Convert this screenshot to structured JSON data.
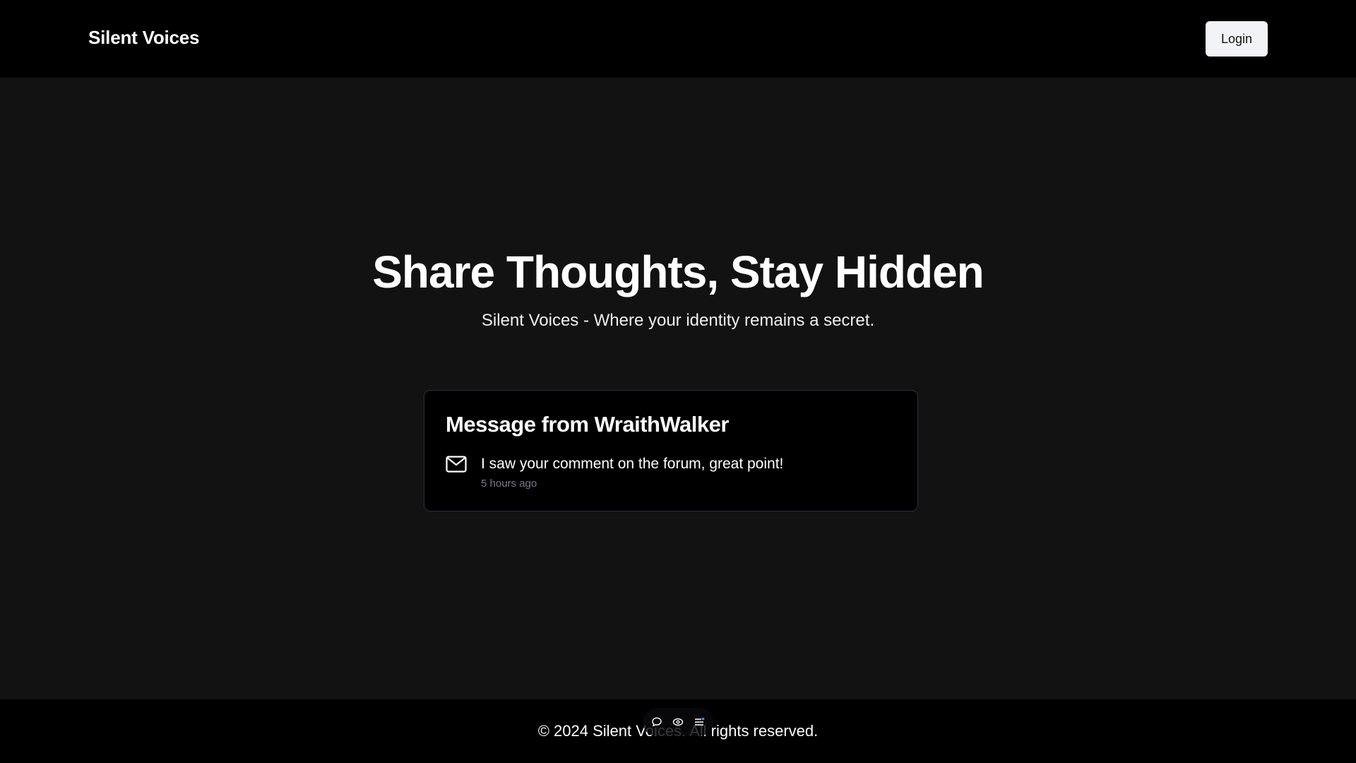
{
  "header": {
    "brand": "Silent Voices",
    "login_label": "Login"
  },
  "hero": {
    "title": "Share Thoughts, Stay Hidden",
    "subtitle": "Silent Voices - Where your identity remains a secret."
  },
  "message_card": {
    "title": "Message from WraithWalker",
    "icon": "mail-icon",
    "text": "I saw your comment on the forum, great point!",
    "time": "5 hours ago"
  },
  "footer": {
    "text": "© 2024 Silent Voices. All rights reserved."
  },
  "floating_toolbar": {
    "icons": [
      "comment-icon",
      "eye-icon",
      "menu-icon"
    ]
  },
  "colors": {
    "page_bg": "#121212",
    "bar_bg": "#000000",
    "button_bg": "#f1f3f6",
    "muted_text": "#737b8c",
    "card_border": "#2b2f3a"
  }
}
